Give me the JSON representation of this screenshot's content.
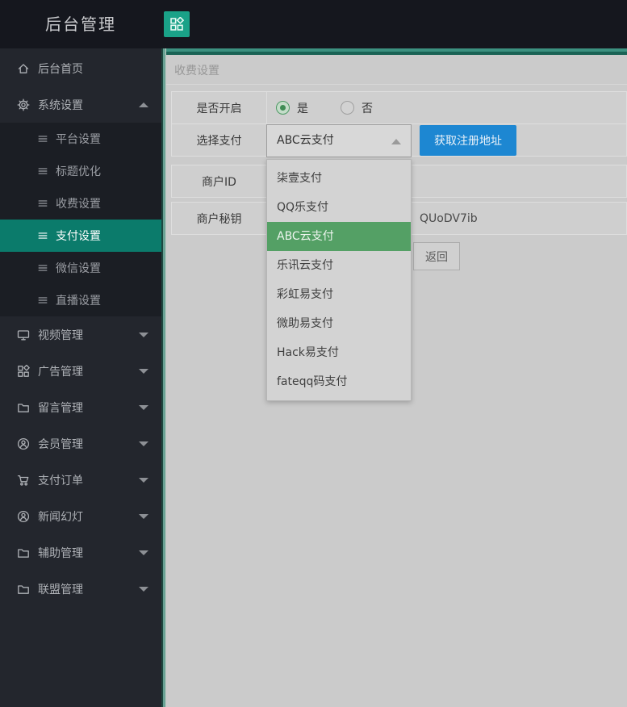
{
  "colors": {
    "accent_teal": "#0b7b6b",
    "header_button_teal": "#1aa288",
    "dropdown_selected_green": "#54a065",
    "primary_blue": "#1d87d2",
    "header_bg": "#15171e",
    "sidebar_bg": "#23262d"
  },
  "header": {
    "brand": "后台管理",
    "app_icon": "app-grid-icon"
  },
  "sidebar": {
    "home": {
      "label": "后台首页",
      "icon": "home-icon"
    },
    "system": {
      "label": "系统设置",
      "icon": "gear-icon",
      "state": "expanded"
    },
    "submenu": [
      {
        "label": "平台设置"
      },
      {
        "label": "标题优化"
      },
      {
        "label": "收费设置"
      },
      {
        "label": "支付设置",
        "active": true
      },
      {
        "label": "微信设置"
      },
      {
        "label": "直播设置"
      }
    ],
    "collapsed_items": [
      {
        "label": "视频管理",
        "icon": "monitor-icon"
      },
      {
        "label": "广告管理",
        "icon": "app-grid-icon"
      },
      {
        "label": "留言管理",
        "icon": "folder-icon"
      },
      {
        "label": "会员管理",
        "icon": "user-circle-icon"
      },
      {
        "label": "支付订单",
        "icon": "cart-icon"
      },
      {
        "label": "新闻幻灯",
        "icon": "user-circle-icon"
      },
      {
        "label": "辅助管理",
        "icon": "folder-icon"
      },
      {
        "label": "联盟管理",
        "icon": "folder-icon"
      }
    ]
  },
  "main": {
    "breadcrumb": "收费设置",
    "form": {
      "enable_label": "是否开启",
      "radio_yes": "是",
      "radio_no": "否",
      "selected_radio": "是",
      "pay_label": "选择支付",
      "pay_value": "ABC云支付",
      "register_button": "获取注册地址",
      "merchant_id_label": "商户ID",
      "merchant_id_value": "",
      "merchant_key_label": "商户秘钥",
      "merchant_key_visible_value": "QUoDV7ib",
      "back_button": "返回"
    },
    "dropdown": {
      "selected": "ABC云支付",
      "options": [
        {
          "label": "柒壹支付"
        },
        {
          "label": "QQ乐支付"
        },
        {
          "label": "ABC云支付",
          "selected": true
        },
        {
          "label": "乐讯云支付"
        },
        {
          "label": "彩虹易支付"
        },
        {
          "label": "微助易支付"
        },
        {
          "label": "Hack易支付"
        },
        {
          "label": "fateqq码支付"
        }
      ]
    }
  }
}
